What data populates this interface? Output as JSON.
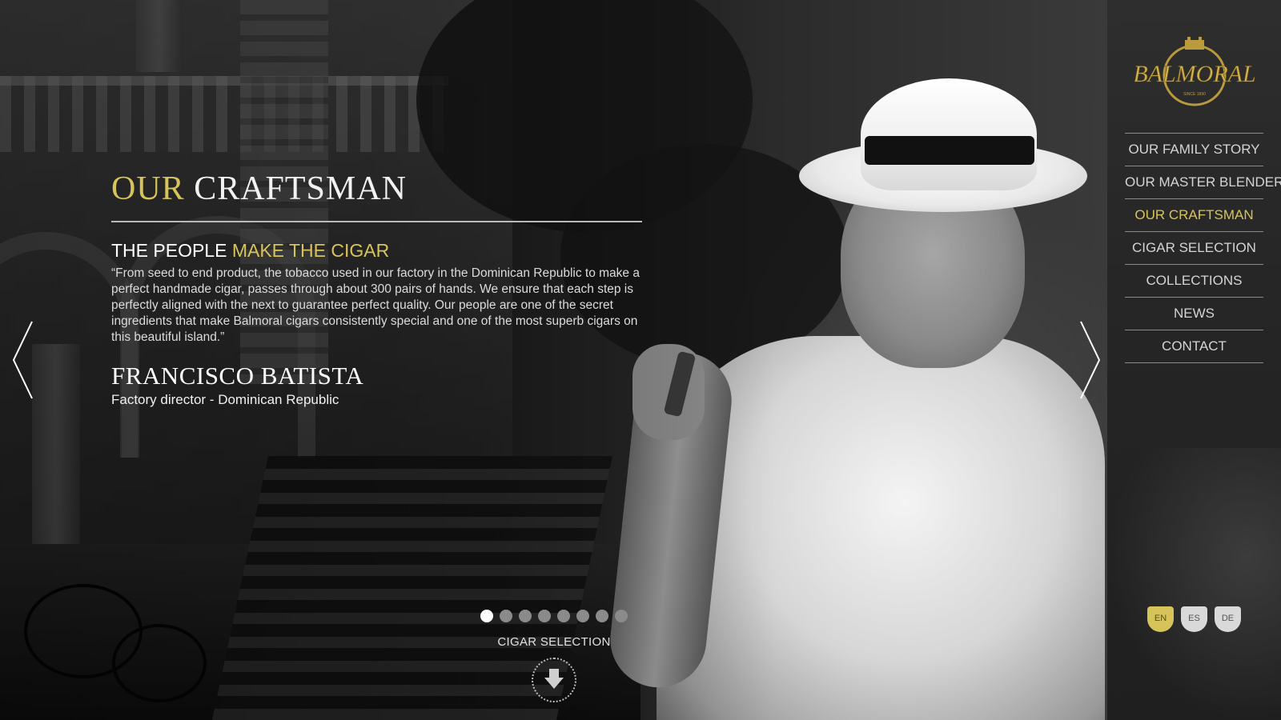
{
  "page": {
    "title_prefix": "OUR",
    "title_main": "CRAFTSMAN",
    "subtitle_prefix": "THE PEOPLE",
    "subtitle_accent": "MAKE THE CIGAR",
    "quote": "“From seed to end product, the tobacco used in our factory in the Dominican Republic to make a perfect handmade cigar, passes through about 300 pairs of hands. We ensure that each step is perfectly aligned with the next to guarantee perfect quality. Our people are one of the secret ingredients that make Balmoral cigars consistently special and one of the most superb cigars on this beautiful island.”",
    "person_name": "FRANCISCO BATISTA",
    "person_role": "Factory director - Dominican Republic"
  },
  "slider": {
    "total": 8,
    "active_index": 0,
    "prev_icon": "chevron-left-icon",
    "next_icon": "chevron-right-icon"
  },
  "next_section": {
    "label": "CIGAR SELECTION",
    "icon": "arrow-down-icon"
  },
  "sidebar": {
    "logo_text": "BALMORAL",
    "logo_tagline": "SINCE 1890",
    "menu": [
      {
        "label": "OUR FAMILY STORY",
        "active": false
      },
      {
        "label": "OUR MASTER BLENDER",
        "active": false
      },
      {
        "label": "OUR CRAFTSMAN",
        "active": true
      },
      {
        "label": "CIGAR SELECTION",
        "active": false
      },
      {
        "label": "COLLECTIONS",
        "active": false
      },
      {
        "label": "NEWS",
        "active": false
      },
      {
        "label": "CONTACT",
        "active": false
      }
    ],
    "languages": [
      {
        "code": "EN",
        "active": true
      },
      {
        "code": "ES",
        "active": false
      },
      {
        "code": "DE",
        "active": false
      }
    ]
  },
  "colors": {
    "accent_gold": "#d6c45a",
    "sidebar_bg": "#2a2a2a",
    "text": "#ffffff"
  }
}
